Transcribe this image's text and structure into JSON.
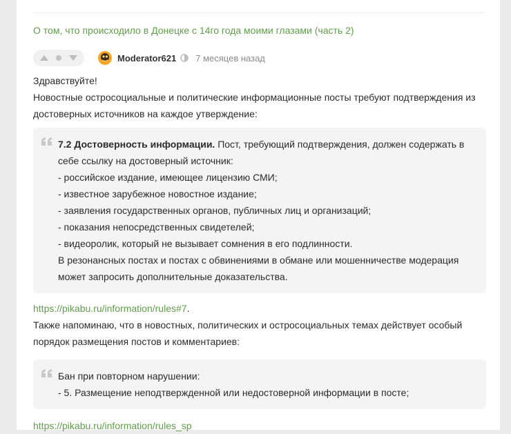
{
  "post": {
    "title_link": "О том, что происходило в Донецке с 14го года моими глазами (часть 2)"
  },
  "comment": {
    "author": "Moderator621",
    "time": "7 месяцев назад",
    "greeting": "Здравствуйте!",
    "intro": "Новостные остросоциальные и политические информационные посты требуют подтверждения из достоверных источников на каждое утверждение:",
    "quote1": {
      "bold": "7.2 Достоверность информации.",
      "lead": " Пост, требующий подтверждения, должен содержать в себе ссылку на достоверный источник:",
      "items": [
        "- российское издание, имеющее лицензию СМИ;",
        "- известное зарубежное новостное издание;",
        "- заявления государственных органов, публичных лиц и организаций;",
        "- показания непосредственных свидетелей;",
        "- видеоролик, который не вызывает сомнения в его подлинности."
      ],
      "closing": "В резонансных постах и постах с обвинениями в обмане или мошенничестве модерация может запросить дополнительные доказательства."
    },
    "link1": "https://pikabu.ru/information/rules#7",
    "link1_suffix": ".",
    "reminder": "Также напоминаю, что в новостных, политических и остросоциальных темах действует особый порядок размещения постов и комментариев:",
    "quote2": {
      "line1": "Бан при повторном нарушении:",
      "line2": "- 5. Размещение неподтвержденной или недостоверной информации в посте;"
    },
    "link2": "https://pikabu.ru/information/rules_sp"
  },
  "icons": {
    "upvote": "triangle-up-icon",
    "downvote": "triangle-down-icon",
    "rating": "dot-icon",
    "status": "moderator-status-icon",
    "quote": "quote-icon"
  },
  "colors": {
    "link": "#5f9e48",
    "quote_bg": "#f4f4f4",
    "vote_bg": "#f1f1f1",
    "icon_gray": "#bdbdbd"
  }
}
